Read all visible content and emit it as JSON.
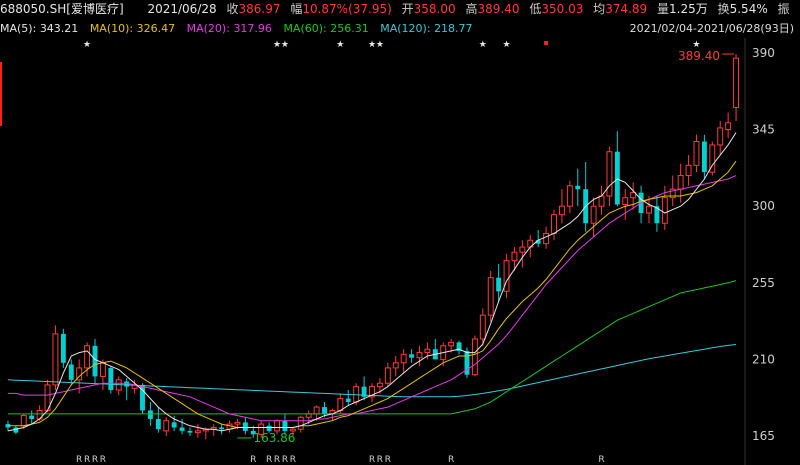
{
  "header": {
    "code": "688050.SH",
    "name": "[爱博医疗]",
    "date": "2021/06/28",
    "close_label": "收",
    "close": "386.97",
    "change_label": "幅",
    "change": "10.87%(37.95)",
    "open_label": "开",
    "open": "358.00",
    "high_label": "高",
    "high": "389.40",
    "low_label": "低",
    "low": "350.03",
    "avg_label": "均",
    "avg": "374.89",
    "volume_label": "量",
    "volume": "1.25万",
    "turnover_label": "换",
    "turnover": "5.54%",
    "amplitude_label": "振"
  },
  "ma_legend": [
    {
      "label": "MA(5):",
      "value": "343.21",
      "color": "#e6e6e6"
    },
    {
      "label": "MA(10):",
      "value": "326.47",
      "color": "#e6c200"
    },
    {
      "label": "MA(20):",
      "value": "317.96",
      "color": "#e040e0"
    },
    {
      "label": "MA(60):",
      "value": "256.31",
      "color": "#22c322"
    },
    {
      "label": "MA(120):",
      "value": "218.77",
      "color": "#3cc8d8"
    }
  ],
  "date_range": "2021/02/04-2021/06/28(93日)",
  "colors": {
    "up": "#ff3b3b",
    "down": "#00d0d0",
    "ma5": "#e6e6e6",
    "ma10": "#e6c200",
    "ma20": "#e040e0",
    "ma60": "#22c322",
    "ma120": "#3cc8d8",
    "axis_text": "#cfcfcf",
    "star": "#e6e6e6",
    "marker": "#ff2020",
    "low_annot": "#22c322",
    "high_annot": "#ff3b3b"
  },
  "chart_data": {
    "type": "candlestick",
    "ylim": [
      155,
      395
    ],
    "yticks": [
      165,
      210,
      255,
      300,
      345,
      390
    ],
    "n": 93,
    "ohlc": [
      [
        172,
        174,
        168,
        170
      ],
      [
        170,
        171,
        166,
        167
      ],
      [
        171,
        178,
        169,
        177
      ],
      [
        177,
        180,
        172,
        175
      ],
      [
        175,
        183,
        174,
        180
      ],
      [
        180,
        198,
        179,
        195
      ],
      [
        195,
        230,
        192,
        225
      ],
      [
        225,
        228,
        205,
        208
      ],
      [
        207,
        210,
        195,
        198
      ],
      [
        198,
        210,
        190,
        205
      ],
      [
        205,
        220,
        200,
        218
      ],
      [
        218,
        222,
        196,
        200
      ],
      [
        200,
        210,
        192,
        208
      ],
      [
        205,
        206,
        190,
        192
      ],
      [
        192,
        200,
        189,
        198
      ],
      [
        197,
        199,
        186,
        194
      ],
      [
        193,
        198,
        190,
        195
      ],
      [
        195,
        196,
        178,
        180
      ],
      [
        180,
        185,
        171,
        175
      ],
      [
        175,
        182,
        167,
        169
      ],
      [
        168,
        176,
        165,
        174
      ],
      [
        173,
        177,
        168,
        170
      ],
      [
        170,
        175,
        166,
        168
      ],
      [
        168,
        170,
        165,
        167
      ],
      [
        167,
        172,
        164,
        168
      ],
      [
        168,
        170,
        163,
        169
      ],
      [
        169,
        172,
        165,
        170
      ],
      [
        170,
        172,
        166,
        169
      ],
      [
        169,
        174,
        167,
        172
      ],
      [
        172,
        175,
        169,
        173
      ],
      [
        173,
        176,
        166,
        168
      ],
      [
        168,
        171,
        164,
        166
      ],
      [
        166,
        174,
        164,
        172
      ],
      [
        171,
        173,
        167,
        168
      ],
      [
        168,
        175,
        166,
        174
      ],
      [
        174,
        178,
        166,
        168
      ],
      [
        168,
        170,
        165,
        169
      ],
      [
        169,
        177,
        167,
        176
      ],
      [
        176,
        180,
        172,
        178
      ],
      [
        178,
        183,
        174,
        182
      ],
      [
        182,
        185,
        176,
        178
      ],
      [
        178,
        181,
        174,
        180
      ],
      [
        180,
        190,
        178,
        187
      ],
      [
        187,
        192,
        183,
        185
      ],
      [
        185,
        196,
        183,
        194
      ],
      [
        194,
        200,
        186,
        188
      ],
      [
        188,
        196,
        185,
        194
      ],
      [
        194,
        199,
        190,
        196
      ],
      [
        196,
        208,
        194,
        205
      ],
      [
        205,
        212,
        200,
        208
      ],
      [
        208,
        216,
        202,
        213
      ],
      [
        213,
        216,
        208,
        211
      ],
      [
        211,
        218,
        206,
        214
      ],
      [
        214,
        220,
        210,
        216
      ],
      [
        216,
        222,
        212,
        210
      ],
      [
        210,
        220,
        206,
        218
      ],
      [
        218,
        222,
        214,
        220
      ],
      [
        220,
        221,
        213,
        215
      ],
      [
        215,
        217,
        199,
        201
      ],
      [
        201,
        224,
        200,
        222
      ],
      [
        222,
        240,
        218,
        236
      ],
      [
        236,
        262,
        232,
        258
      ],
      [
        258,
        266,
        244,
        250
      ],
      [
        250,
        272,
        246,
        268
      ],
      [
        268,
        276,
        262,
        273
      ],
      [
        273,
        280,
        264,
        276
      ],
      [
        276,
        283,
        270,
        280
      ],
      [
        280,
        286,
        276,
        278
      ],
      [
        278,
        288,
        275,
        284
      ],
      [
        284,
        298,
        280,
        295
      ],
      [
        295,
        310,
        290,
        300
      ],
      [
        300,
        315,
        296,
        312
      ],
      [
        312,
        322,
        300,
        310
      ],
      [
        310,
        326,
        285,
        290
      ],
      [
        290,
        305,
        282,
        300
      ],
      [
        300,
        312,
        295,
        306
      ],
      [
        306,
        335,
        300,
        332
      ],
      [
        332,
        344,
        300,
        301
      ],
      [
        301,
        310,
        292,
        305
      ],
      [
        305,
        314,
        298,
        308
      ],
      [
        308,
        312,
        290,
        296
      ],
      [
        296,
        306,
        290,
        300
      ],
      [
        300,
        306,
        285,
        290
      ],
      [
        290,
        312,
        286,
        305
      ],
      [
        305,
        318,
        300,
        310
      ],
      [
        310,
        325,
        302,
        318
      ],
      [
        318,
        330,
        312,
        324
      ],
      [
        324,
        342,
        320,
        338
      ],
      [
        338,
        342,
        316,
        320
      ],
      [
        320,
        338,
        318,
        336
      ],
      [
        336,
        350,
        330,
        346
      ],
      [
        345,
        355,
        340,
        349
      ],
      [
        358,
        389.4,
        350.03,
        386.97
      ]
    ],
    "ma5": [
      168,
      169,
      170,
      172,
      175,
      180,
      190,
      202,
      212,
      214,
      215,
      210,
      208,
      206,
      204,
      200,
      196,
      192,
      187,
      182,
      178,
      175,
      173,
      171,
      170,
      169,
      169,
      168,
      169,
      170,
      170,
      170,
      170,
      170,
      170,
      170,
      170,
      171,
      173,
      175,
      177,
      178,
      180,
      183,
      185,
      187,
      189,
      191,
      194,
      198,
      202,
      206,
      209,
      212,
      213,
      214,
      215,
      216,
      214,
      214,
      219,
      231,
      244,
      256,
      263,
      270,
      276,
      280,
      282,
      284,
      287,
      290,
      294,
      300,
      304,
      306,
      312,
      316,
      314,
      309,
      304,
      301,
      299,
      296,
      298,
      300,
      304,
      310,
      316,
      324,
      330,
      336,
      343.21
    ],
    "ma10": [
      171,
      171,
      171,
      172,
      173,
      176,
      181,
      188,
      195,
      200,
      204,
      207,
      208,
      209,
      207,
      205,
      202,
      199,
      196,
      193,
      190,
      187,
      184,
      181,
      178,
      176,
      174,
      172,
      171,
      170,
      170,
      170,
      170,
      170,
      170,
      170,
      170,
      171,
      171,
      172,
      173,
      174,
      176,
      177,
      179,
      181,
      183,
      185,
      187,
      190,
      193,
      196,
      199,
      202,
      205,
      208,
      210,
      212,
      212,
      213,
      215,
      221,
      228,
      234,
      239,
      244,
      248,
      252,
      257,
      263,
      269,
      275,
      280,
      284,
      288,
      292,
      296,
      298,
      300,
      301,
      303,
      304,
      305,
      306,
      306,
      306,
      307,
      308,
      310,
      312,
      316,
      320,
      326.47
    ],
    "ma20": [
      190,
      190,
      189,
      189,
      189,
      189,
      190,
      191,
      192,
      193,
      194,
      195,
      196,
      196,
      196,
      196,
      195,
      194,
      193,
      192,
      191,
      190,
      189,
      188,
      186,
      184,
      182,
      180,
      178,
      177,
      176,
      175,
      174,
      174,
      174,
      174,
      174,
      174,
      174,
      175,
      175,
      176,
      177,
      178,
      178,
      179,
      180,
      181,
      182,
      184,
      186,
      188,
      190,
      192,
      194,
      196,
      198,
      201,
      204,
      207,
      211,
      215,
      219,
      224,
      230,
      236,
      242,
      248,
      254,
      259,
      264,
      269,
      274,
      278,
      282,
      286,
      290,
      293,
      296,
      299,
      302,
      304,
      306,
      308,
      309,
      310,
      311,
      312,
      313,
      314,
      315,
      316,
      317.96
    ],
    "ma60": [
      178,
      178,
      178,
      178,
      178,
      178,
      178,
      178,
      178,
      178,
      178,
      178,
      178,
      178,
      178,
      178,
      178,
      178,
      178,
      178,
      178,
      178,
      178,
      178,
      178,
      178,
      178,
      178,
      178,
      178,
      178,
      178,
      178,
      178,
      178,
      178,
      178,
      178,
      178,
      178,
      178,
      178,
      178,
      178,
      178,
      178,
      178,
      178,
      178,
      178,
      178,
      178,
      178,
      178,
      178,
      178,
      178,
      179,
      180,
      181,
      183,
      185,
      188,
      191,
      194,
      197,
      200,
      203,
      206,
      209,
      212,
      215,
      218,
      221,
      224,
      227,
      230,
      233,
      235,
      237,
      239,
      241,
      243,
      245,
      247,
      249,
      250,
      251,
      252,
      253,
      254,
      255,
      256.31
    ],
    "ma120": [
      198,
      197.8,
      197.6,
      197.4,
      197.2,
      197,
      196.8,
      196.6,
      196.4,
      196.2,
      196,
      195.8,
      195.6,
      195.4,
      195.2,
      195,
      194.8,
      194.6,
      194.4,
      194.2,
      194,
      193.8,
      193.6,
      193.4,
      193.2,
      193,
      192.8,
      192.6,
      192.4,
      192.2,
      192,
      191.8,
      191.6,
      191.4,
      191.2,
      191,
      190.8,
      190.6,
      190.4,
      190.2,
      190,
      189.8,
      189.6,
      189.4,
      189.2,
      189,
      188.8,
      188.6,
      188.4,
      188.2,
      188,
      188,
      188,
      188,
      188,
      188,
      188,
      188.3,
      188.8,
      189.4,
      190,
      190.8,
      191.6,
      192.4,
      193.4,
      194.4,
      195.4,
      196.4,
      197.4,
      198.4,
      199.4,
      200.4,
      201.4,
      202.4,
      203.4,
      204.4,
      205.4,
      206.4,
      207.4,
      208.4,
      209.4,
      210.4,
      211.2,
      212,
      212.8,
      213.6,
      214.4,
      215.2,
      216,
      216.8,
      217.6,
      218.2,
      218.77
    ],
    "stars": [
      10,
      34,
      35,
      42,
      46,
      47,
      60,
      63,
      87
    ],
    "red_marks": [
      68
    ],
    "r_labels": [
      9,
      10,
      11,
      12,
      31,
      33,
      34,
      35,
      36,
      46,
      47,
      48,
      56,
      75
    ],
    "annotations": [
      {
        "text": "163.86",
        "index": 29,
        "value": 163.86,
        "kind": "low"
      },
      {
        "text": "389.40",
        "index": 92,
        "value": 389.4,
        "kind": "high"
      }
    ]
  }
}
